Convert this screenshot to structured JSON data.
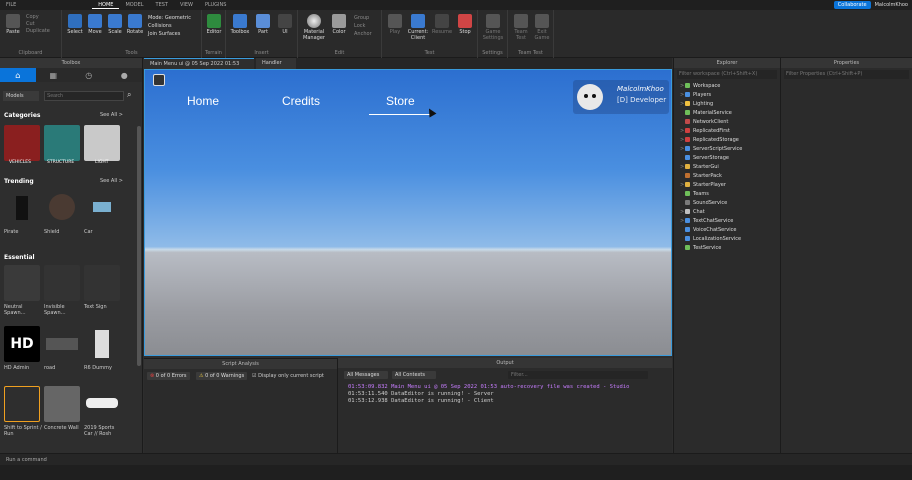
{
  "menubar": {
    "tabs": [
      "FILE",
      "HOME",
      "MODEL",
      "TEST",
      "VIEW",
      "PLUGINS"
    ],
    "active": "HOME"
  },
  "topright": {
    "collaborate": "Collaborate",
    "user": "MalcolmKhoo"
  },
  "ribbon": {
    "clipboard": {
      "label": "Clipboard",
      "paste": "Paste",
      "copy": "Copy",
      "cut": "Cut",
      "duplicate": "Duplicate"
    },
    "tools": {
      "label": "Tools",
      "select": "Select",
      "move": "Move",
      "scale": "Scale",
      "rotate": "Rotate",
      "mode": "Mode:",
      "mode_value": "Geometric",
      "collisions": "Collisions",
      "join": "Join Surfaces"
    },
    "terrain": {
      "label": "Terrain",
      "editor": "Editor"
    },
    "insert": {
      "label": "Insert",
      "toolbox": "Toolbox",
      "part": "Part",
      "ui": "UI"
    },
    "edit": {
      "label": "Edit",
      "material": "Material Manager",
      "color": "Color",
      "group": "Group",
      "lock": "Lock",
      "anchor": "Anchor"
    },
    "test": {
      "label": "Test",
      "play": "Play",
      "current_client": "Current: Client",
      "resume": "Resume",
      "stop": "Stop"
    },
    "settings": {
      "label": "Settings",
      "game_settings": "Game Settings"
    },
    "teamtest": {
      "label": "Team Test",
      "team_test": "Team Test",
      "exit_game": "Exit Game"
    }
  },
  "toolbox": {
    "title": "Toolbox",
    "dropdown": "Models",
    "search_placeholder": "Search",
    "categories": {
      "title": "Categories",
      "see_all": "See All >",
      "items": [
        "VEHICLES",
        "STRUCTURE",
        "LIGHT"
      ]
    },
    "trending": {
      "title": "Trending",
      "see_all": "See All >",
      "items": [
        "Pirate",
        "Shield",
        "Car"
      ]
    },
    "essential": {
      "title": "Essential",
      "items": [
        "Neutral Spawn…",
        "Invisible Spawn…",
        "Text Sign",
        "HD Admin",
        "road",
        "R6 Dummy",
        "Shift to Sprint / Run",
        "Concrete Wall",
        "2019 Sports Car // Rosh"
      ]
    }
  },
  "doctabs": {
    "main": "Main Menu ui @ 05 Sep 2022 01:53",
    "handler": "Handler"
  },
  "viewport": {
    "nav": {
      "home": "Home",
      "credits": "Credits",
      "store": "Store"
    },
    "profile": {
      "name": "MalcolmKhoo",
      "role": "[D] Developer"
    }
  },
  "explorer": {
    "title": "Explorer",
    "filter": "Filter workspace (Ctrl+Shift+X)",
    "items": [
      {
        "label": "Workspace",
        "color": "#6fbf5a",
        "caret": ">"
      },
      {
        "label": "Players",
        "color": "#4a90e2",
        "caret": ">"
      },
      {
        "label": "Lighting",
        "color": "#f0c040",
        "caret": ">"
      },
      {
        "label": "MaterialService",
        "color": "#6fbf5a",
        "caret": ""
      },
      {
        "label": "NetworkClient",
        "color": "#c04a4a",
        "caret": ""
      },
      {
        "label": "ReplicatedFirst",
        "color": "#d04040",
        "caret": ">"
      },
      {
        "label": "ReplicatedStorage",
        "color": "#d04040",
        "caret": ">"
      },
      {
        "label": "ServerScriptService",
        "color": "#4a90e2",
        "caret": ">"
      },
      {
        "label": "ServerStorage",
        "color": "#4a90e2",
        "caret": ""
      },
      {
        "label": "StarterGui",
        "color": "#e0b040",
        "caret": ">"
      },
      {
        "label": "StarterPack",
        "color": "#c07030",
        "caret": ""
      },
      {
        "label": "StarterPlayer",
        "color": "#e0b040",
        "caret": ">"
      },
      {
        "label": "Teams",
        "color": "#6fbf5a",
        "caret": ""
      },
      {
        "label": "SoundService",
        "color": "#7a7a7a",
        "caret": ""
      },
      {
        "label": "Chat",
        "color": "#c0c0c0",
        "caret": ">"
      },
      {
        "label": "TextChatService",
        "color": "#4a90e2",
        "caret": ">"
      },
      {
        "label": "VoiceChatService",
        "color": "#4a90e2",
        "caret": ""
      },
      {
        "label": "LocalizationService",
        "color": "#4a90e2",
        "caret": ""
      },
      {
        "label": "TestService",
        "color": "#6fbf5a",
        "caret": ""
      }
    ]
  },
  "properties": {
    "title": "Properties",
    "filter": "Filter Properties (Ctrl+Shift+P)"
  },
  "scriptanalysis": {
    "title": "Script Analysis",
    "errors": "0 of 0 Errors",
    "warnings": "0 of 0 Warnings",
    "display_only": "Display only current script"
  },
  "output": {
    "title": "Output",
    "messages": "All Messages",
    "contexts": "All Contexts",
    "filter": "Filter...",
    "lines": [
      {
        "time": "01:53:09.832",
        "text": "Main Menu ui @ 05 Sep 2022 01:53 auto-recovery file was created - Studio",
        "color": "#c77dff"
      },
      {
        "time": "01:53:11.540",
        "text": "DataEditor is running!  - Server",
        "color": "#cfcfcf"
      },
      {
        "time": "01:53:12.938",
        "text": "DataEditor is running!  - Client",
        "color": "#cfcfcf"
      }
    ]
  },
  "cmdbar": {
    "placeholder": "Run a command"
  }
}
